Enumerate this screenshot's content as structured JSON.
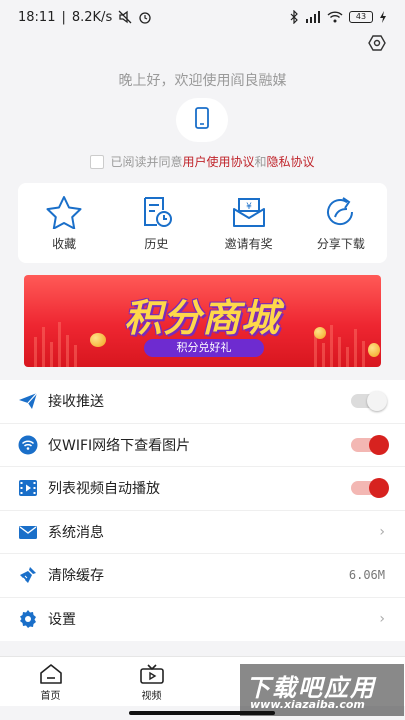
{
  "status_bar": {
    "time": "18:11",
    "net_speed": "8.2K/s",
    "battery": "43"
  },
  "header": {
    "greeting": "晚上好，欢迎使用阎良融媒",
    "agree_prefix": "已阅读并同意",
    "user_agreement": "用户使用协议",
    "and": "和",
    "privacy_policy": "隐私协议"
  },
  "quick_actions": [
    {
      "label": "收藏",
      "icon": "star-icon"
    },
    {
      "label": "历史",
      "icon": "history-icon"
    },
    {
      "label": "邀请有奖",
      "icon": "invite-gift-icon"
    },
    {
      "label": "分享下载",
      "icon": "share-icon"
    }
  ],
  "banner": {
    "title": "积分商城",
    "pill": "积分兑好礼"
  },
  "settings_list": [
    {
      "label": "接收推送",
      "icon": "paper-plane-icon",
      "control": "toggle",
      "state": "off"
    },
    {
      "label": "仅WIFI网络下查看图片",
      "icon": "wifi-icon",
      "control": "toggle",
      "state": "on"
    },
    {
      "label": "列表视频自动播放",
      "icon": "film-icon",
      "control": "toggle",
      "state": "on"
    },
    {
      "label": "系统消息",
      "icon": "mail-icon",
      "control": "chevron"
    },
    {
      "label": "清除缓存",
      "icon": "broom-icon",
      "control": "value",
      "value": "6.06M"
    },
    {
      "label": "设置",
      "icon": "gear-icon",
      "control": "chevron"
    }
  ],
  "tabbar": [
    {
      "label": "首页",
      "icon": "home-icon"
    },
    {
      "label": "视频",
      "icon": "video-icon"
    }
  ],
  "watermark": {
    "title": "下载吧应用",
    "url": "www.xiazaiba.com"
  },
  "colors": {
    "accent_red": "#c0242b",
    "icon_blue": "#1a6fc9",
    "toggle_on": "#d7221f"
  }
}
